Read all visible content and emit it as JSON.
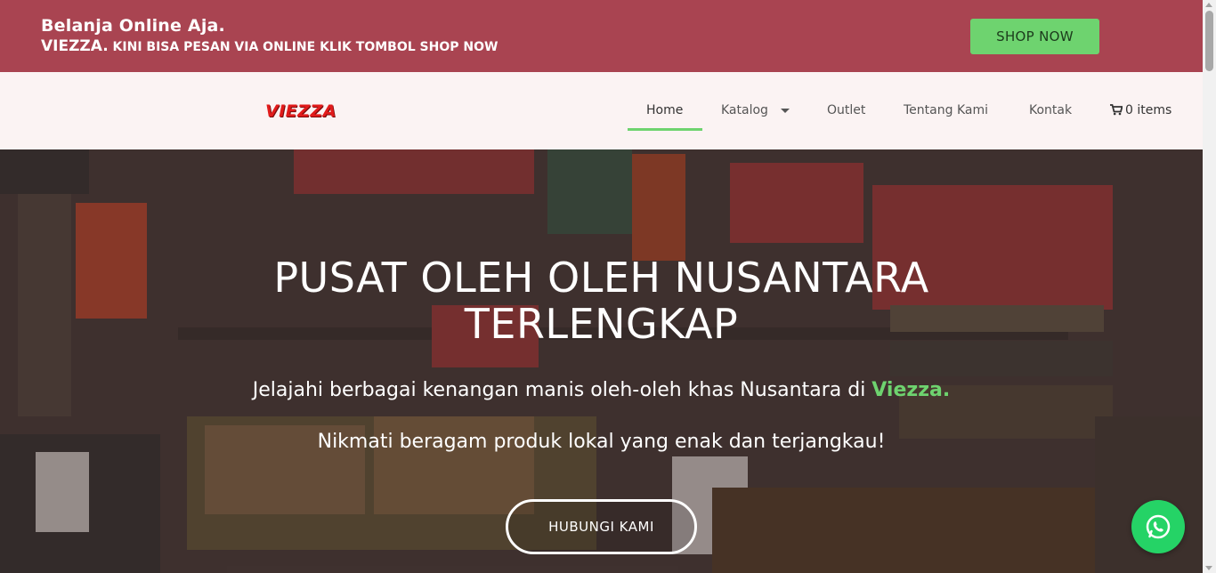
{
  "promo": {
    "line1": "Belanja Online Aja.",
    "brand": "VIEZZA.",
    "line2": " KINI BISA PESAN VIA ONLINE KLIK TOMBOL SHOP NOW",
    "button": "SHOP NOW"
  },
  "nav": {
    "logo": "VIEZZA",
    "items": [
      "Home",
      "Katalog",
      "Outlet",
      "Tentang Kami",
      "Kontak"
    ],
    "cart": "0 items"
  },
  "hero": {
    "title_line1": "PUSAT OLEH OLEH NUSANTARA",
    "title_line2": "TERLENGKAP",
    "sub1_prefix": "Jelajahi berbagai kenangan manis oleh-oleh khas Nusantara di ",
    "sub1_brand": "Viezza.",
    "sub2": "Nikmati beragam produk lokal yang enak dan terjangkau!",
    "button": "HUBUNGI KAMI"
  },
  "colors": {
    "promo_bg": "#a94451",
    "accent_green": "#6ed36f",
    "logo_red": "#e11b1b",
    "whatsapp": "#25d366"
  }
}
